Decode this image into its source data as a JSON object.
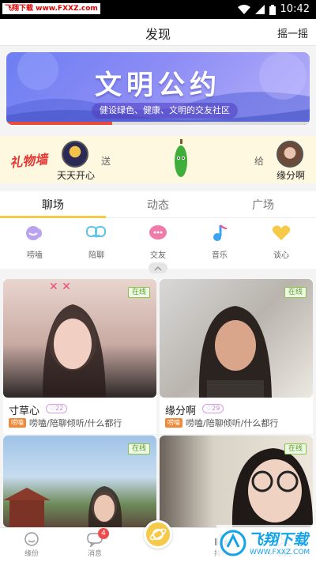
{
  "status_bar": {
    "watermark": "飞翔下载 www.FXXZ.com",
    "time": "10:42"
  },
  "nav": {
    "title": "发现",
    "action": "摇一摇"
  },
  "banner": {
    "title": "文明公约",
    "subtitle": "健设绿色、健康、文明的交友社区",
    "carousel_progress": 0.35
  },
  "gift_bar": {
    "logo_text": "礼物墙",
    "sender": "天天开心",
    "send_word": "送",
    "give_word": "给",
    "receiver": "缘分啊"
  },
  "tabs": [
    {
      "label": "聊场",
      "active": true
    },
    {
      "label": "动态",
      "active": false
    },
    {
      "label": "广场",
      "active": false
    }
  ],
  "categories": [
    {
      "label": "唠嗑",
      "icon": "chat-bubble-icon",
      "color": "#b9a3f0"
    },
    {
      "label": "陪聊",
      "icon": "heart-bubbles-icon",
      "color": "#5ec4e8"
    },
    {
      "label": "交友",
      "icon": "chat-heart-icon",
      "color": "#f07aaa"
    },
    {
      "label": "音乐",
      "icon": "music-note-icon",
      "color": "#3aa4f2"
    },
    {
      "label": "谈心",
      "icon": "heart-icon",
      "color": "#f7c948"
    }
  ],
  "cards": [
    {
      "name": "寸草心",
      "likes": "22",
      "status": "在线",
      "tag": "唠嗑",
      "desc": "唠嗑/陪聊倾听/什么都行"
    },
    {
      "name": "缘分啊",
      "likes": "29",
      "status": "在线",
      "tag": "唠嗑",
      "desc": "唠嗑/陪聊倾听/什么都行"
    },
    {
      "name": "",
      "likes": "",
      "status": "在线",
      "tag": "",
      "desc": ""
    },
    {
      "name": "",
      "likes": "",
      "status": "在线",
      "tag": "",
      "desc": ""
    }
  ],
  "bottom_nav": [
    {
      "label": "缘份",
      "icon": "face-icon"
    },
    {
      "label": "消息",
      "icon": "message-icon",
      "badge": "4"
    },
    {
      "label": "",
      "icon": "planet-icon"
    },
    {
      "label": "排行",
      "icon": "ranking-icon"
    },
    {
      "label": "我的",
      "icon": "profile-icon"
    }
  ],
  "site_watermark": {
    "title": "飞翔下载",
    "url": "WWW.FXXZ.COM"
  },
  "colors": {
    "accent": "#f7c948",
    "online": "#8bc34a",
    "tag": "#ef8a3a",
    "badge": "#f04a4a"
  }
}
